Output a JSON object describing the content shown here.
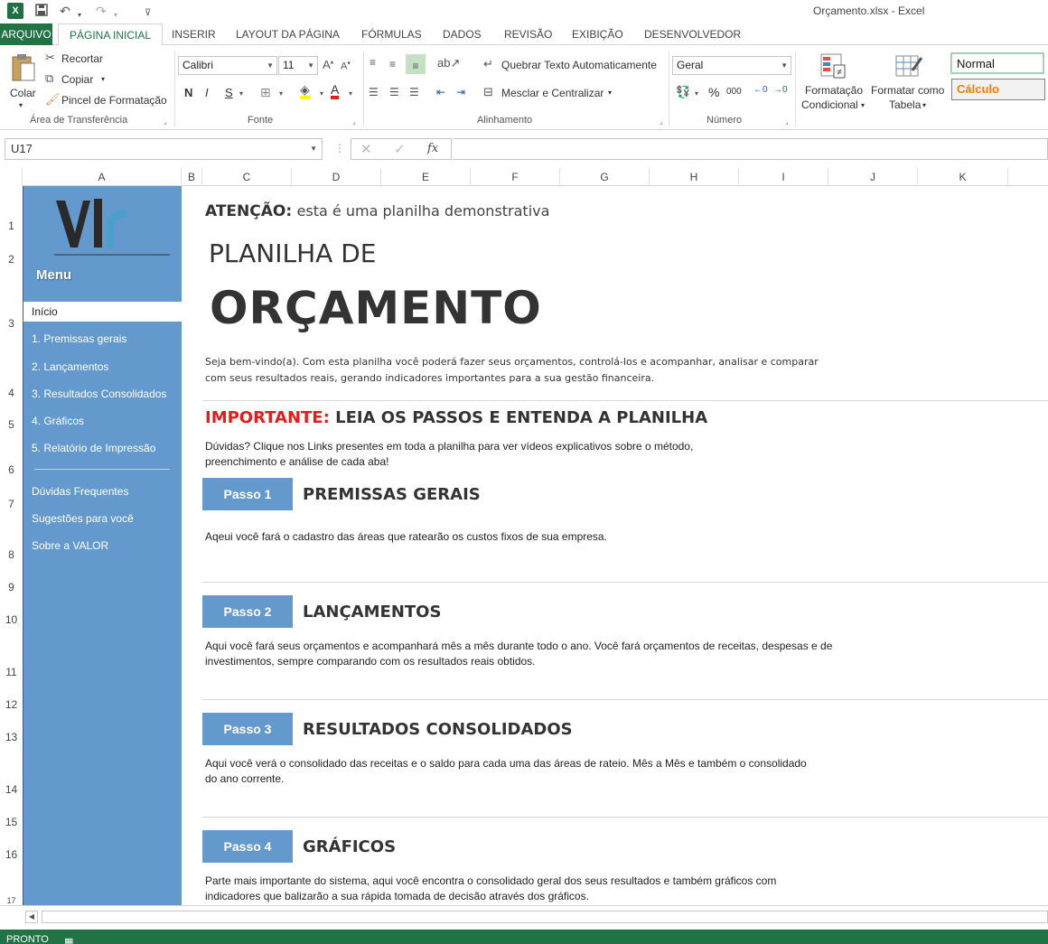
{
  "window": {
    "title": "Orçamento.xlsx - Excel",
    "app_icon_letter": "X"
  },
  "tabs": {
    "file": "ARQUIVO",
    "items": [
      "PÁGINA INICIAL",
      "INSERIR",
      "LAYOUT DA PÁGINA",
      "FÓRMULAS",
      "DADOS",
      "REVISÃO",
      "EXIBIÇÃO",
      "DESENVOLVEDOR"
    ]
  },
  "ribbon": {
    "clipboard": {
      "paste": "Colar",
      "cut": "Recortar",
      "copy": "Copiar",
      "format_painter": "Pincel de Formatação",
      "label": "Área de Transferência"
    },
    "font": {
      "name": "Calibri",
      "size": "11",
      "bold": "N",
      "italic": "I",
      "underline": "S",
      "label": "Fonte"
    },
    "alignment": {
      "wrap": "Quebrar Texto Automaticamente",
      "merge": "Mesclar e Centralizar",
      "label": "Alinhamento"
    },
    "number": {
      "format": "Geral",
      "percent": "%",
      "thousands": "000",
      "label": "Número"
    },
    "styles": {
      "conditional_1": "Formatação",
      "conditional_2": "Condicional",
      "table_1": "Formatar como",
      "table_2": "Tabela",
      "normal": "Normal",
      "calc": "Cálculo"
    }
  },
  "formula_bar": {
    "cell_ref": "U17",
    "fx": "fx",
    "value": ""
  },
  "columns": [
    "A",
    "B",
    "C",
    "D",
    "E",
    "F",
    "G",
    "H",
    "I",
    "J",
    "K"
  ],
  "rows": [
    "1",
    "2",
    "3",
    "4",
    "5",
    "6",
    "7",
    "8",
    "9",
    "10",
    "11",
    "12",
    "13",
    "14",
    "15",
    "16",
    "17"
  ],
  "sidebar": {
    "logo_text": "VLr",
    "menu_title": "Menu",
    "items": [
      {
        "label": "Início",
        "active": true
      },
      {
        "label": "1. Premissas gerais"
      },
      {
        "label": "2. Lançamentos"
      },
      {
        "label": "3. Resultados Consolidados"
      },
      {
        "label": "4. Gráficos"
      },
      {
        "label": "5. Relatório de Impressão"
      },
      {
        "label": "Dúvidas Frequentes"
      },
      {
        "label": "Sugestões para você"
      },
      {
        "label": "Sobre a VALOR"
      }
    ]
  },
  "content": {
    "attention_label": "ATENÇÃO:",
    "attention_text": "esta é uma planilha demonstrativa",
    "title_small": "PLANILHA DE",
    "title_big": "ORÇAMENTO",
    "welcome": "Seja bem-vindo(a). Com esta planilha você poderá fazer seus orçamentos, controlá-los e acompanhar, analisar e comparar com seus resultados reais, gerando indicadores importantes para a sua gestão financeira.",
    "important_label": "IMPORTANTE:",
    "important_text": "LEIA OS PASSOS E ENTENDA A PLANILHA",
    "doubts": "Dúvidas? Clique nos Links presentes em toda a planilha para ver vídeos explicativos sobre o método, preenchimento e análise de cada aba!",
    "steps": [
      {
        "badge": "Passo 1",
        "title": "PREMISSAS GERAIS",
        "desc": "Aqeui você fará o cadastro das áreas que ratearão os custos fixos de sua empresa."
      },
      {
        "badge": "Passo 2",
        "title": "LANÇAMENTOS",
        "desc": "Aqui você fará seus orçamentos e acompanhará mês a mês durante todo o ano. Você fará orçamentos de receitas, despesas e de investimentos, sempre comparando com os resultados reais obtidos."
      },
      {
        "badge": "Passo 3",
        "title": "RESULTADOS CONSOLIDADOS",
        "desc": "Aqui você verá o consolidado das receitas e o saldo para cada uma das áreas de rateio. Mês a Mês e também o consolidado do ano corrente."
      },
      {
        "badge": "Passo 4",
        "title": "GRÁFICOS",
        "desc": "Parte mais importante do sistema, aqui você encontra o consolidado geral dos seus resultados e também gráficos com indicadores que balizarão a sua rápida tomada de decisão através dos gráficos."
      }
    ]
  },
  "status": {
    "text": "PRONTO"
  },
  "colors": {
    "excel_green": "#217346",
    "sidebar_blue": "#6399cc",
    "important_red": "#e31c1c",
    "calc_orange": "#fa7d00"
  }
}
